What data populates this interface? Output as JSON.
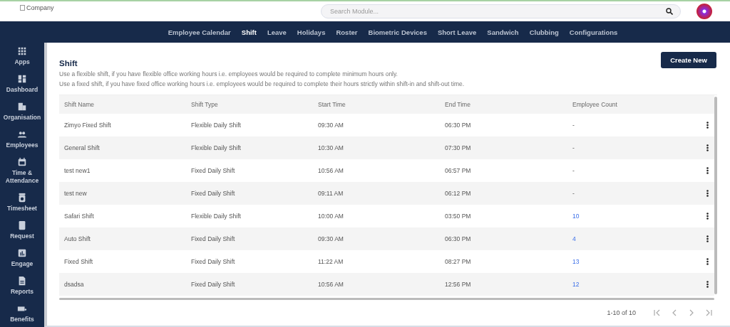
{
  "header": {
    "logo_alt": "Company",
    "search": {
      "placeholder": "Search Module..."
    }
  },
  "nav": [
    {
      "label": "Employee Calendar",
      "selected": false
    },
    {
      "label": "Shift",
      "selected": true
    },
    {
      "label": "Leave",
      "selected": false
    },
    {
      "label": "Holidays",
      "selected": false
    },
    {
      "label": "Roster",
      "selected": false
    },
    {
      "label": "Biometric Devices",
      "selected": false
    },
    {
      "label": "Short Leave",
      "selected": false
    },
    {
      "label": "Sandwich",
      "selected": false
    },
    {
      "label": "Clubbing",
      "selected": false
    },
    {
      "label": "Configurations",
      "selected": false
    }
  ],
  "sidebar": {
    "items": [
      "Apps",
      "Dashboard",
      "Organisation",
      "Employees",
      "Time & Attendance",
      "Timesheet",
      "Request",
      "Engage",
      "Reports",
      "Benefits"
    ]
  },
  "page": {
    "title": "Shift",
    "button": "Create New",
    "descriptions": [
      "Use a flexible shift, if you have flexible office working hours i.e. employees would be required to complete minimum hours only.",
      "Use a fixed shift, if you have fixed office working hours i.e. employees would be required to complete their hours strictly within shift-in and shift-out time."
    ]
  },
  "table": {
    "columns": [
      "Shift Name",
      "Shift Type",
      "Start Time",
      "End Time",
      "Employee Count"
    ],
    "rows": [
      {
        "name": "Zimyo Fixed Shift",
        "type": "Flexible Daily Shift",
        "start": "09:30 AM",
        "end": "06:30 PM",
        "count": "-",
        "linked": false
      },
      {
        "name": "General Shift",
        "type": "Flexible Daily Shift",
        "start": "10:30 AM",
        "end": "07:30 PM",
        "count": "-",
        "linked": false
      },
      {
        "name": "test new1",
        "type": "Fixed Daily Shift",
        "start": "10:56 AM",
        "end": "06:57 PM",
        "count": "-",
        "linked": false
      },
      {
        "name": "test new",
        "type": "Fixed Daily Shift",
        "start": "09:11 AM",
        "end": "06:12 PM",
        "count": "-",
        "linked": false
      },
      {
        "name": "Safari Shift",
        "type": "Flexible Daily Shift",
        "start": "10:00 AM",
        "end": "03:50 PM",
        "count": "10",
        "linked": true
      },
      {
        "name": "Auto Shift",
        "type": "Fixed Daily Shift",
        "start": "09:30 AM",
        "end": "06:30 PM",
        "count": "4",
        "linked": true
      },
      {
        "name": "Fixed Shift",
        "type": "Fixed Daily Shift",
        "start": "11:22 AM",
        "end": "08:27 PM",
        "count": "13",
        "linked": true
      },
      {
        "name": "dsadsa",
        "type": "Fixed Daily Shift",
        "start": "10:56 AM",
        "end": "12:56 PM",
        "count": "12",
        "linked": true
      }
    ]
  },
  "pagination": {
    "range": "1-10 of 10",
    "buttons": [
      {
        "kind": "first",
        "disabled": true
      },
      {
        "kind": "prev",
        "disabled": true
      },
      {
        "kind": "next",
        "disabled": true
      },
      {
        "kind": "last",
        "disabled": true
      }
    ]
  }
}
